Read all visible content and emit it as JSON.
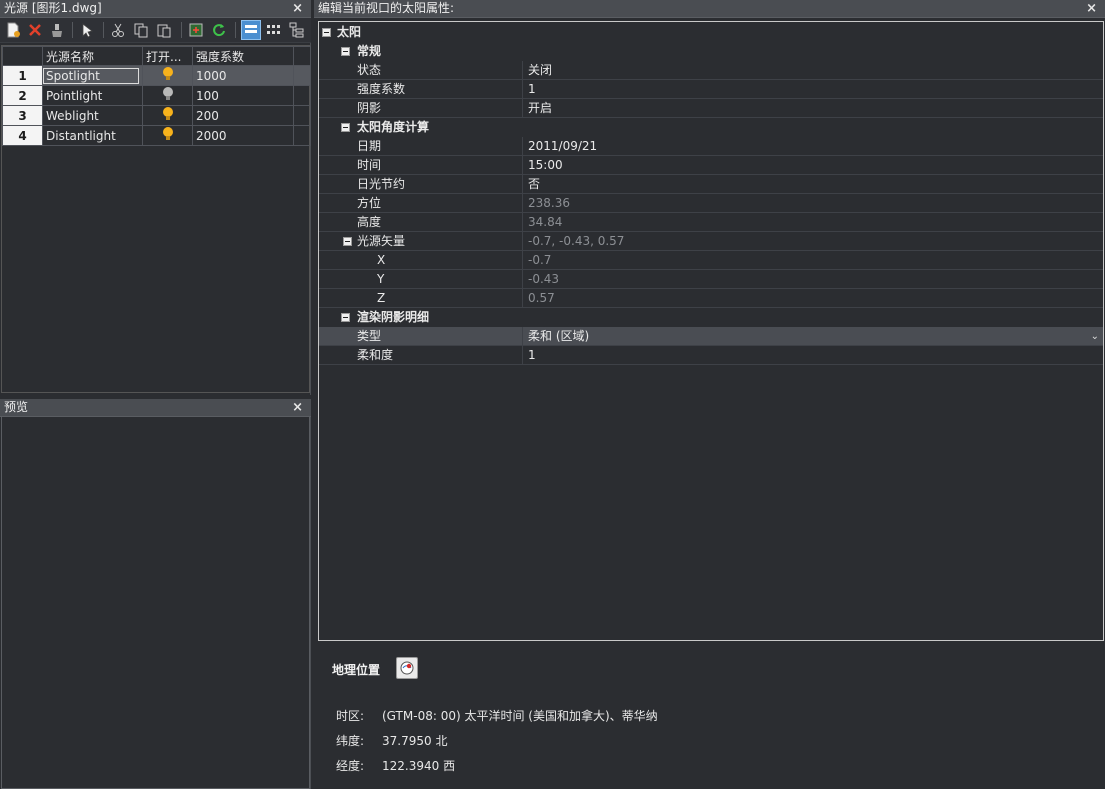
{
  "lights_panel": {
    "title": "光源 [图形1.dwg]",
    "close": "×",
    "toolbar": [
      "new-light",
      "delete-light",
      "light-brush",
      "select",
      "cut",
      "copy",
      "paste",
      "insert",
      "refresh",
      "view-grid-large",
      "view-grid-small",
      "view-tree"
    ],
    "columns": [
      "光源名称",
      "打开...",
      "强度系数"
    ],
    "rows": [
      {
        "num": "1",
        "name": "Spotlight",
        "on": true,
        "intensity": "1000"
      },
      {
        "num": "2",
        "name": "Pointlight",
        "on": false,
        "intensity": "100"
      },
      {
        "num": "3",
        "name": "Weblight",
        "on": true,
        "intensity": "200"
      },
      {
        "num": "4",
        "name": "Distantlight",
        "on": true,
        "intensity": "2000"
      }
    ]
  },
  "preview_panel": {
    "title": "预览",
    "close": "×"
  },
  "sun_panel": {
    "title": "编辑当前视口的太阳属性:",
    "close": "×",
    "root": "太阳",
    "general": {
      "label": "常规",
      "status_label": "状态",
      "status_value": "关闭",
      "intensity_label": "强度系数",
      "intensity_value": "1",
      "shadow_label": "阴影",
      "shadow_value": "开启"
    },
    "angle": {
      "label": "太阳角度计算",
      "date_label": "日期",
      "date_value": "2011/09/21",
      "time_label": "时间",
      "time_value": "15:00",
      "dst_label": "日光节约",
      "dst_value": "否",
      "azimuth_label": "方位",
      "azimuth_value": "238.36",
      "altitude_label": "高度",
      "altitude_value": "34.84",
      "vector_label": "光源矢量",
      "vector_value": "-0.7, -0.43, 0.57",
      "x_label": "X",
      "x_value": "-0.7",
      "y_label": "Y",
      "y_value": "-0.43",
      "z_label": "Z",
      "z_value": "0.57"
    },
    "shadow_detail": {
      "label": "渲染阴影明细",
      "type_label": "类型",
      "type_value": "柔和 (区域)",
      "softness_label": "柔和度",
      "softness_value": "1"
    },
    "geo": {
      "title": "地理位置",
      "timezone_label": "时区:",
      "timezone_value": "(GTM-08: 00) 太平洋时间 (美国和加拿大)、蒂华纳",
      "latitude_label": "纬度:",
      "latitude_value": "37.7950 北",
      "longitude_label": "经度:",
      "longitude_value": "122.3940 西"
    }
  },
  "colors": {
    "bulb_on": "#f7b21c",
    "bulb_off": "#b9b9b9",
    "accent": "#4b8fd0"
  }
}
